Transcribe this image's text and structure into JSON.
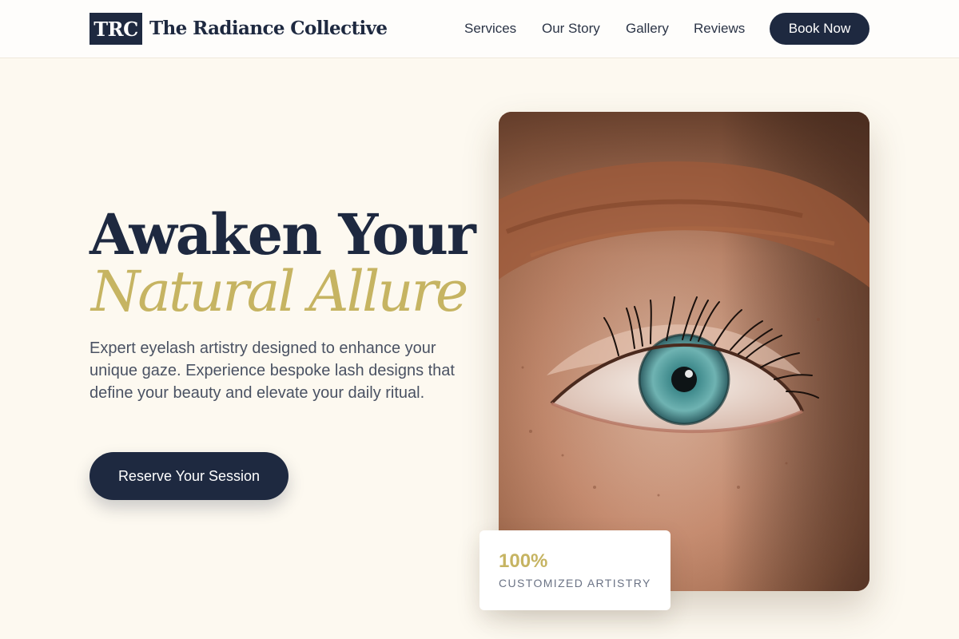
{
  "header": {
    "logo_text": "TRC",
    "brand_name": "The Radiance Collective",
    "nav": [
      {
        "label": "Services"
      },
      {
        "label": "Our Story"
      },
      {
        "label": "Gallery"
      },
      {
        "label": "Reviews"
      }
    ],
    "cta_label": "Book Now"
  },
  "hero": {
    "title_line1": "Awaken Your",
    "title_line2": "Natural Allure",
    "description": "Expert eyelash artistry designed to enhance your unique gaze. Experience bespoke lash designs that define your beauty and elevate your daily ritual.",
    "cta_label": "Reserve Your Session",
    "image_alt": "close-up of a blue-green eye with long lashes"
  },
  "stat": {
    "value": "100%",
    "label": "CUSTOMIZED ARTISTRY"
  },
  "colors": {
    "navy": "#1e2940",
    "gold": "#c6b462",
    "cream": "#fdf9f0"
  }
}
